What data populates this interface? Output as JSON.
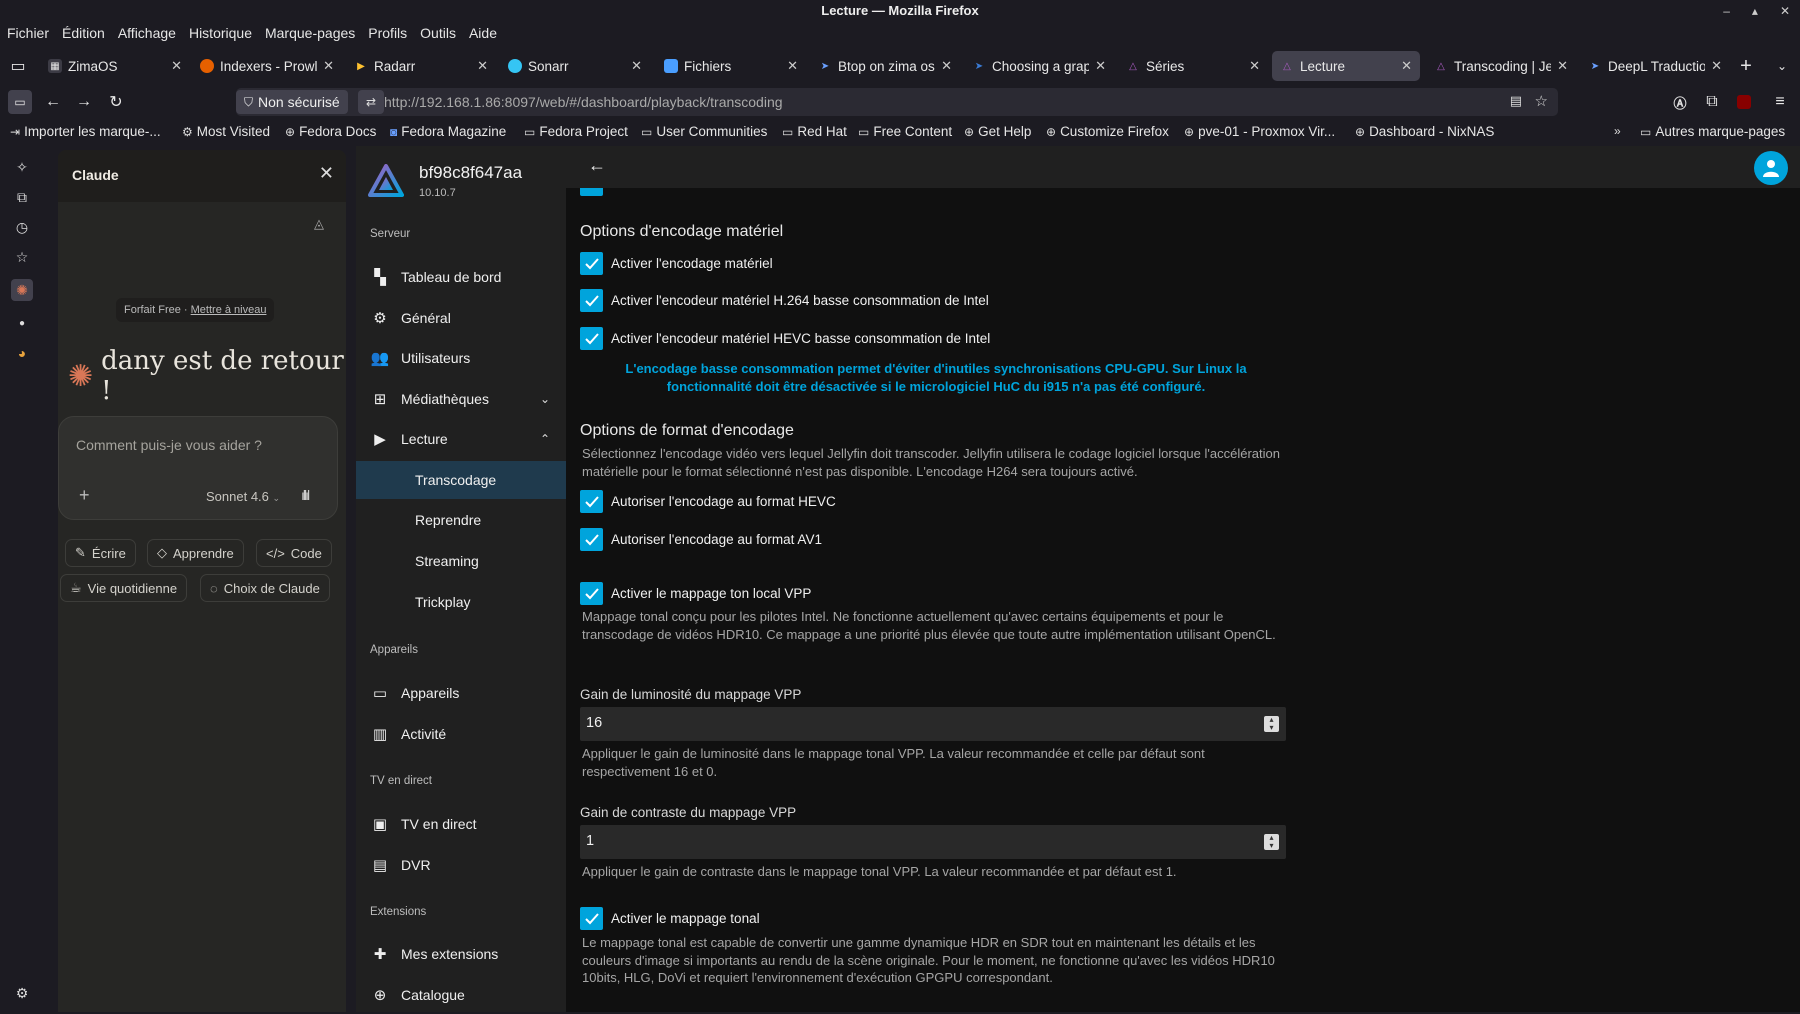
{
  "window": {
    "title": "Lecture — Mozilla Firefox"
  },
  "menubar": [
    "Fichier",
    "Édition",
    "Affichage",
    "Historique",
    "Marque-pages",
    "Profils",
    "Outils",
    "Aide"
  ],
  "tabs": [
    {
      "label": "ZimaOS",
      "icon": "zimaos-icon",
      "color": "#9aa0ff"
    },
    {
      "label": "Indexers - Prowlar",
      "icon": "prowlarr-icon",
      "color": "#e66000"
    },
    {
      "label": "Radarr",
      "icon": "radarr-icon",
      "color": "#ffc230"
    },
    {
      "label": "Sonarr",
      "icon": "sonarr-icon",
      "color": "#35c5f4"
    },
    {
      "label": "Fichiers",
      "icon": "files-icon",
      "color": "#4a9eff"
    },
    {
      "label": "Btop on zima os",
      "icon": "doc-icon",
      "color": "#6aa0ff"
    },
    {
      "label": "Choosing a graphi",
      "icon": "doc-icon",
      "color": "#3a7bd5"
    },
    {
      "label": "Séries",
      "icon": "jellyfin-icon",
      "color": "#aa5cc3"
    },
    {
      "label": "Lecture",
      "icon": "jellyfin-icon",
      "color": "#aa5cc3"
    },
    {
      "label": "Transcoding | Jellyf",
      "icon": "jellyfin-icon",
      "color": "#aa5cc3"
    },
    {
      "label": "DeepL Traduction",
      "icon": "deepl-icon",
      "color": "#0f2b46"
    }
  ],
  "navbar": {
    "security": "Non sécurisé",
    "url_host": "http://192.168.1.86",
    "url_path": ":8097/web/#/dashboard/playback/transcoding"
  },
  "bookmarks": [
    "Importer les marque-...",
    "Most Visited",
    "Fedora Docs",
    "Fedora Magazine",
    "Fedora Project",
    "User Communities",
    "Red Hat",
    "Free Content",
    "Get Help",
    "Customize Firefox",
    "pve-01 - Proxmox Vir...",
    "Dashboard - NixNAS",
    "Autres marque-pages"
  ],
  "claude": {
    "title": "Claude",
    "plan": "Forfait Free",
    "upgrade": "Mettre à niveau",
    "greeting": "dany est de retour !",
    "prompt_placeholder": "Comment puis-je vous aider ?",
    "model": "Sonnet 4.6",
    "chips": [
      "Écrire",
      "Apprendre",
      "Code",
      "Vie quotidienne",
      "Choix de Claude"
    ],
    "accent": "#d97757"
  },
  "jellyfin": {
    "server_name": "bf98c8f647aa",
    "version": "10.10.7",
    "sections": {
      "serveur": "Serveur",
      "appareils": "Appareils",
      "tv": "TV en direct",
      "extensions": "Extensions"
    },
    "nav": {
      "dashboard": "Tableau de bord",
      "general": "Général",
      "users": "Utilisateurs",
      "libraries": "Médiathèques",
      "playback": "Lecture",
      "transcoding": "Transcodage",
      "resume": "Reprendre",
      "streaming": "Streaming",
      "trickplay": "Trickplay",
      "devices": "Appareils",
      "activity": "Activité",
      "livetv": "TV en direct",
      "dvr": "DVR",
      "myplugins": "Mes extensions",
      "catalog": "Catalogue"
    },
    "accent": "#00a4dc"
  },
  "settings": {
    "hw_heading": "Options d'encodage matériel",
    "hw_enable": "Activer l'encodage matériel",
    "hw_h264_lp": "Activer l'encodeur matériel H.264 basse consommation de Intel",
    "hw_hevc_lp": "Activer l'encodeur matériel HEVC basse consommation de Intel",
    "lp_warning": "L'encodage basse consommation permet d'éviter d'inutiles synchronisations CPU-GPU. Sur Linux la fonctionnalité doit être désactivée si le micrologiciel HuC du i915 n'a pas été configuré.",
    "format_heading": "Options de format d'encodage",
    "format_desc": "Sélectionnez l'encodage vidéo vers lequel Jellyfin doit transcoder. Jellyfin utilisera le codage logiciel lorsque l'accélération matérielle pour le format sélectionné n'est pas disponible. L'encodage H264 sera toujours activé.",
    "allow_hevc": "Autoriser l'encodage au format HEVC",
    "allow_av1": "Autoriser l'encodage au format AV1",
    "vpp_tonemap": "Activer le mappage ton local VPP",
    "vpp_tonemap_desc": "Mappage tonal conçu pour les pilotes Intel. Ne fonctionne actuellement qu'avec certains équipements et pour le transcodage de vidéos HDR10. Ce mappage a une priorité plus élevée que toute autre implémentation utilisant OpenCL.",
    "vpp_brightness_label": "Gain de luminosité du mappage VPP",
    "vpp_brightness_value": "16",
    "vpp_brightness_desc": "Appliquer le gain de luminosité dans le mappage tonal VPP. La valeur recommandée et celle par défaut sont respectivement 16 et 0.",
    "vpp_contrast_label": "Gain de contraste du mappage VPP",
    "vpp_contrast_value": "1",
    "vpp_contrast_desc": "Appliquer le gain de contraste dans le mappage tonal VPP. La valeur recommandée et par défaut est 1.",
    "tonemap": "Activer le mappage tonal",
    "tonemap_desc": "Le mappage tonal est capable de convertir une gamme dynamique HDR en SDR tout en maintenant les détails et les couleurs d'image si importants au rendu de la scène originale. Pour le moment, ne fonctionne qu'avec les vidéos HDR10 10bits, HLG, DoVi et requiert l'environnement d'exécution GPGPU correspondant."
  }
}
